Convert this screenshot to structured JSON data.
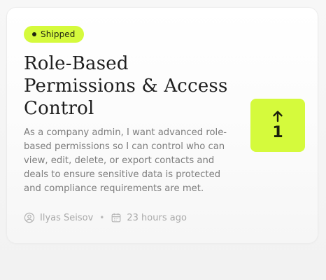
{
  "card": {
    "status": "Shipped",
    "title": "Role-Based Permissions & Access Control",
    "description": "As a company admin, I want advanced role-based permissions so I can control who can view, edit, delete, or export contacts and deals to ensure sensitive data is protected and compliance requirements are met.",
    "author": "Ilyas Seisov",
    "separator": "•",
    "time": "23 hours ago",
    "upvote": {
      "icon": "arrow-up-icon",
      "count": "1"
    }
  },
  "icons": {
    "author": "user-circle-icon",
    "time": "calendar-icon"
  },
  "colors": {
    "accent": "#d5fa3c",
    "title": "#1e1e1e",
    "muted": "#7d7d7d",
    "meta": "#a9a9a9"
  }
}
